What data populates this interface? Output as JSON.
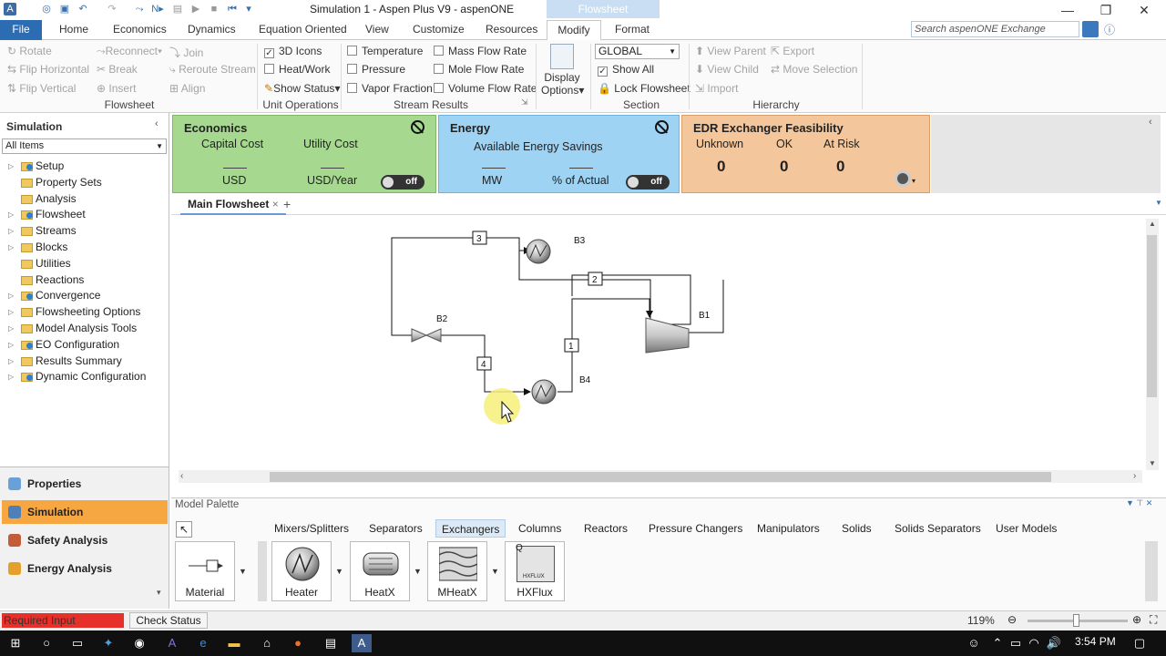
{
  "app": {
    "title": "Simulation 1 - Aspen Plus V9 - aspenONE",
    "context_tab": "Flowsheet"
  },
  "ribbon_tabs": [
    "File",
    "Home",
    "Economics",
    "Dynamics",
    "Equation Oriented",
    "View",
    "Customize",
    "Resources",
    "Modify",
    "Format"
  ],
  "search": {
    "placeholder": "Search aspenONE Exchange"
  },
  "ribbon": {
    "flowsheet": {
      "rotate": "Rotate",
      "flip_h": "Flip Horizontal",
      "flip_v": "Flip Vertical",
      "reconnect": "Reconnect",
      "break": "Break",
      "insert": "Insert",
      "join": "Join",
      "reroute": "Reroute Stream",
      "align": "Align",
      "label": "Flowsheet"
    },
    "unit_ops": {
      "icons3d": "3D Icons",
      "heatwork": "Heat/Work",
      "showstatus": "Show Status",
      "label": "Unit Operations"
    },
    "stream": {
      "temp": "Temperature",
      "pres": "Pressure",
      "vapfrac": "Vapor Fraction",
      "massflow": "Mass Flow Rate",
      "moleflow": "Mole Flow Rate",
      "volflow": "Volume Flow Rate",
      "label": "Stream Results"
    },
    "display": {
      "line1": "Display",
      "line2": "Options"
    },
    "section": {
      "select": "GLOBAL",
      "showall": "Show All",
      "lock": "Lock Flowsheet",
      "label": "Section"
    },
    "hierarchy": {
      "viewparent": "View Parent",
      "viewchild": "View Child",
      "import": "Import",
      "export": "Export",
      "movesel": "Move Selection",
      "label": "Hierarchy"
    }
  },
  "sidebar": {
    "header": "Simulation",
    "filter": "All Items",
    "items": [
      {
        "label": "Setup",
        "expand": true,
        "check": true
      },
      {
        "label": "Property Sets",
        "expand": false,
        "check": false
      },
      {
        "label": "Analysis",
        "expand": false,
        "check": false
      },
      {
        "label": "Flowsheet",
        "expand": true,
        "check": true
      },
      {
        "label": "Streams",
        "expand": true,
        "check": false
      },
      {
        "label": "Blocks",
        "expand": true,
        "check": false
      },
      {
        "label": "Utilities",
        "expand": false,
        "check": false
      },
      {
        "label": "Reactions",
        "expand": false,
        "check": false
      },
      {
        "label": "Convergence",
        "expand": true,
        "check": true
      },
      {
        "label": "Flowsheeting Options",
        "expand": true,
        "check": false
      },
      {
        "label": "Model Analysis Tools",
        "expand": true,
        "check": false
      },
      {
        "label": "EO Configuration",
        "expand": true,
        "check": true
      },
      {
        "label": "Results Summary",
        "expand": true,
        "check": false
      },
      {
        "label": "Dynamic Configuration",
        "expand": true,
        "check": true
      }
    ]
  },
  "nav": [
    "Properties",
    "Simulation",
    "Safety Analysis",
    "Energy Analysis"
  ],
  "economics": {
    "title": "Economics",
    "capital": "Capital Cost",
    "utility": "Utility Cost",
    "usd": "USD",
    "usdyear": "USD/Year",
    "toggle": "off"
  },
  "energy": {
    "title": "Energy",
    "savings": "Available Energy Savings",
    "mw": "MW",
    "pct": "% of Actual",
    "toggle": "off"
  },
  "edr": {
    "title": "EDR Exchanger Feasibility",
    "unknown": "Unknown",
    "ok": "OK",
    "atrisk": "At Risk",
    "v_unknown": "0",
    "v_ok": "0",
    "v_atrisk": "0"
  },
  "flowsheet_tab": "Main Flowsheet",
  "flowsheet": {
    "blocks": {
      "b1": "B1",
      "b2": "B2",
      "b3": "B3",
      "b4": "B4"
    },
    "streams": {
      "s1": "1",
      "s2": "2",
      "s3": "3",
      "s4": "4"
    }
  },
  "palette": {
    "header": "Model Palette",
    "tabs": [
      "Mixers/Splitters",
      "Separators",
      "Exchangers",
      "Columns",
      "Reactors",
      "Pressure Changers",
      "Manipulators",
      "Solids",
      "Solids Separators",
      "User Models"
    ],
    "items": [
      "Material",
      "Heater",
      "HeatX",
      "MHeatX",
      "HXFlux"
    ],
    "hxflux_q": "Q",
    "hxflux_caption": "HXFLUX"
  },
  "status": {
    "required": "Required Input Incomplete",
    "check": "Check Status",
    "zoom": "119%"
  },
  "taskbar": {
    "time": "3:54 PM"
  },
  "colors": {
    "economics": "#a6d890",
    "energy": "#9fd3f3",
    "edr": "#f3c69c",
    "file": "#2b6cb3",
    "active_nav": "#f6a742",
    "required": "#e8302a"
  }
}
